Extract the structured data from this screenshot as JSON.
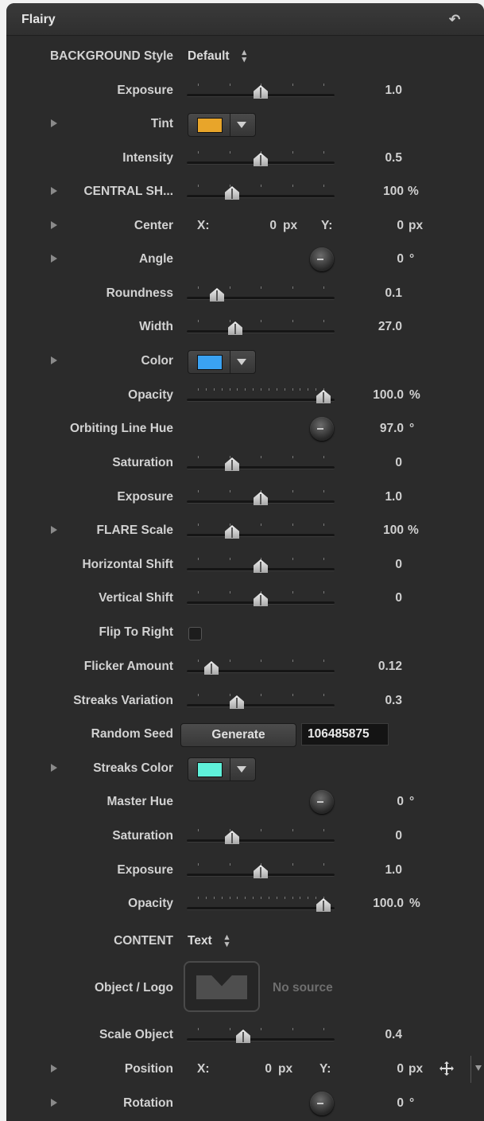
{
  "panel": {
    "title": "Flairy"
  },
  "rows": {
    "bg_style": {
      "label": "BACKGROUND Style",
      "value": "Default"
    },
    "exposure1": {
      "label": "Exposure",
      "value": "1.0",
      "level": 0.5
    },
    "tint": {
      "label": "Tint",
      "color": "#e8a52a"
    },
    "intensity": {
      "label": "Intensity",
      "value": "0.5",
      "level": 0.5
    },
    "central": {
      "label": "CENTRAL SH...",
      "value": "100",
      "unit": "%",
      "level": 0.27
    },
    "center": {
      "label": "Center",
      "x_label": "X:",
      "x_value": "0",
      "x_unit": "px",
      "y_label": "Y:",
      "y_value": "0",
      "y_unit": "px"
    },
    "angle": {
      "label": "Angle",
      "value": "0",
      "unit": "°"
    },
    "roundness": {
      "label": "Roundness",
      "value": "0.1",
      "level": 0.15
    },
    "width": {
      "label": "Width",
      "value": "27.0",
      "level": 0.3
    },
    "color": {
      "label": "Color",
      "color": "#3aa2f2"
    },
    "opacity1": {
      "label": "Opacity",
      "value": "100.0",
      "unit": "%",
      "level": 1.0
    },
    "orbit_hue": {
      "label": "Orbiting Line Hue",
      "value": "97.0",
      "unit": "°"
    },
    "saturation1": {
      "label": "Saturation",
      "value": "0",
      "level": 0.27
    },
    "exposure2": {
      "label": "Exposure",
      "value": "1.0",
      "level": 0.5
    },
    "flare_scale": {
      "label": "FLARE Scale",
      "value": "100",
      "unit": "%",
      "level": 0.27
    },
    "h_shift": {
      "label": "Horizontal Shift",
      "value": "0",
      "level": 0.5
    },
    "v_shift": {
      "label": "Vertical Shift",
      "value": "0",
      "level": 0.5
    },
    "flip": {
      "label": "Flip To Right",
      "checked": false
    },
    "flicker": {
      "label": "Flicker Amount",
      "value": "0.12",
      "level": 0.11
    },
    "streaks_var": {
      "label": "Streaks Variation",
      "value": "0.3",
      "level": 0.31
    },
    "seed": {
      "label": "Random Seed",
      "button": "Generate",
      "value": "106485875"
    },
    "streaks_color": {
      "label": "Streaks Color",
      "color": "#5ff1da"
    },
    "master_hue": {
      "label": "Master Hue",
      "value": "0",
      "unit": "°"
    },
    "saturation2": {
      "label": "Saturation",
      "value": "0",
      "level": 0.27
    },
    "exposure3": {
      "label": "Exposure",
      "value": "1.0",
      "level": 0.5
    },
    "opacity2": {
      "label": "Opacity",
      "value": "100.0",
      "unit": "%",
      "level": 1.0
    },
    "content": {
      "label": "CONTENT",
      "value": "Text"
    },
    "object_logo": {
      "label": "Object / Logo",
      "placeholder": "No source"
    },
    "scale_object": {
      "label": "Scale Object",
      "value": "0.4",
      "level": 0.36
    },
    "position": {
      "label": "Position",
      "x_label": "X:",
      "x_value": "0",
      "x_unit": "px",
      "y_label": "Y:",
      "y_value": "0",
      "y_unit": "px"
    },
    "rotation": {
      "label": "Rotation",
      "value": "0",
      "unit": "°"
    }
  }
}
